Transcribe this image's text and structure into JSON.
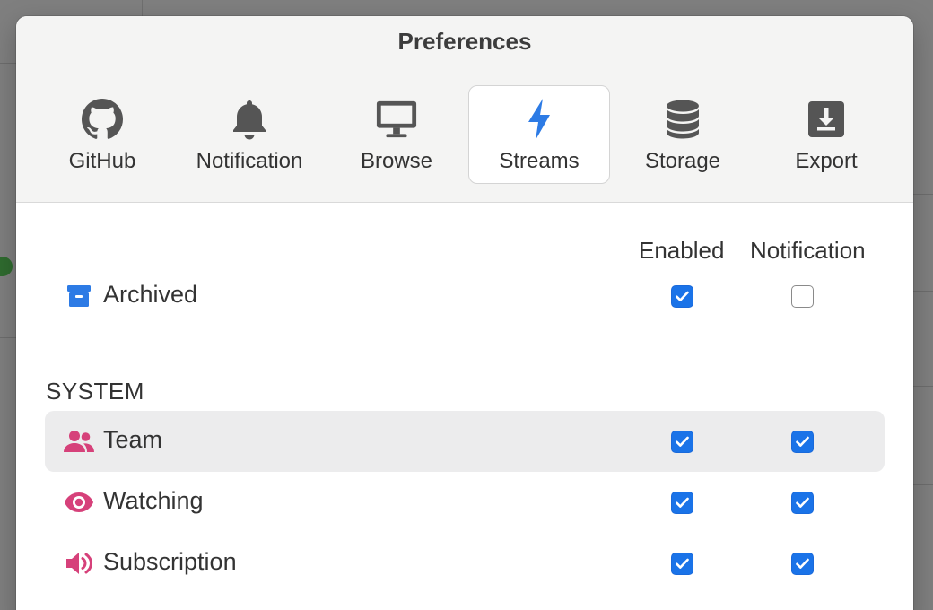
{
  "dialog": {
    "title": "Preferences"
  },
  "tabs": [
    {
      "label": "GitHub",
      "icon": "github-icon",
      "active": false
    },
    {
      "label": "Notification",
      "icon": "bell-icon",
      "active": false
    },
    {
      "label": "Browse",
      "icon": "monitor-icon",
      "active": false
    },
    {
      "label": "Streams",
      "icon": "lightning-icon",
      "active": true
    },
    {
      "label": "Storage",
      "icon": "database-icon",
      "active": false
    },
    {
      "label": "Export",
      "icon": "download-icon",
      "active": false
    }
  ],
  "columns": {
    "enabled": "Enabled",
    "notification": "Notification"
  },
  "streams": [
    {
      "label": "Archived",
      "icon": "archive-icon",
      "icon_color": "#2d7be5",
      "enabled": true,
      "notification": false
    }
  ],
  "system": {
    "heading": "SYSTEM",
    "items": [
      {
        "label": "Team",
        "icon": "team-icon",
        "icon_color": "#d6417a",
        "enabled": true,
        "notification": true,
        "highlighted": true
      },
      {
        "label": "Watching",
        "icon": "eye-icon",
        "icon_color": "#d6417a",
        "enabled": true,
        "notification": true,
        "highlighted": false
      },
      {
        "label": "Subscription",
        "icon": "speaker-icon",
        "icon_color": "#d6417a",
        "enabled": true,
        "notification": true,
        "highlighted": false
      }
    ]
  },
  "colors": {
    "accent": "#1a73e8",
    "active_tab_icon": "#2d7be5",
    "tab_icon": "#555555"
  }
}
